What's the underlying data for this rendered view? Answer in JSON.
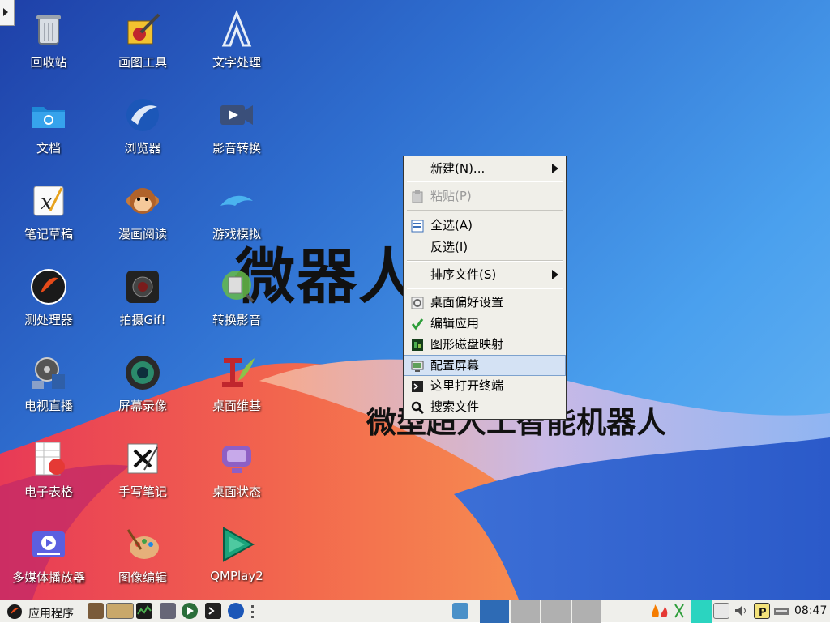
{
  "desktop": {
    "brand_title": "微器人",
    "brand_subtitle": "微型超人工智能机器人",
    "icons": [
      {
        "label": "回收站",
        "icon": "trash-icon"
      },
      {
        "label": "画图工具",
        "icon": "paint-icon"
      },
      {
        "label": "文字处理",
        "icon": "text-processor-icon"
      },
      {
        "label": "文档",
        "icon": "folder-icon"
      },
      {
        "label": "浏览器",
        "icon": "browser-icon"
      },
      {
        "label": "影音转换",
        "icon": "video-convert-icon"
      },
      {
        "label": "笔记草稿",
        "icon": "note-icon"
      },
      {
        "label": "漫画阅读",
        "icon": "comic-icon"
      },
      {
        "label": "游戏模拟",
        "icon": "dolphin-icon"
      },
      {
        "label": "测处理器",
        "icon": "cpu-test-icon"
      },
      {
        "label": "拍摄Gif!",
        "icon": "camera-icon"
      },
      {
        "label": "转换影音",
        "icon": "media-convert-icon"
      },
      {
        "label": "电视直播",
        "icon": "tv-icon"
      },
      {
        "label": "屏幕录像",
        "icon": "screen-record-icon"
      },
      {
        "label": "桌面维基",
        "icon": "wiki-icon"
      },
      {
        "label": "电子表格",
        "icon": "spreadsheet-icon"
      },
      {
        "label": "手写笔记",
        "icon": "handwriting-icon"
      },
      {
        "label": "桌面状态",
        "icon": "monitor-status-icon"
      },
      {
        "label": "多媒体播放器",
        "icon": "media-player-icon"
      },
      {
        "label": "图像编辑",
        "icon": "image-edit-icon"
      },
      {
        "label": "QMPlay2",
        "icon": "qmplay-icon"
      }
    ]
  },
  "context_menu": {
    "items": [
      {
        "label": "新建(N)...",
        "submenu": true,
        "enabled": true
      },
      {
        "label": "粘贴(P)",
        "enabled": false
      },
      {
        "label": "全选(A)",
        "enabled": true
      },
      {
        "label": "反选(I)",
        "enabled": true
      },
      {
        "label": "排序文件(S)",
        "submenu": true,
        "enabled": true
      },
      {
        "label": "桌面偏好设置",
        "enabled": true
      },
      {
        "label": "编辑应用",
        "enabled": true
      },
      {
        "label": "图形磁盘映射",
        "enabled": true
      },
      {
        "label": "配置屏幕",
        "enabled": true,
        "highlighted": true
      },
      {
        "label": "这里打开终端",
        "enabled": true
      },
      {
        "label": "搜索文件",
        "enabled": true
      }
    ]
  },
  "taskbar": {
    "start_label": "应用程序",
    "clock": "08:47",
    "accent": "#2e6bb5"
  }
}
